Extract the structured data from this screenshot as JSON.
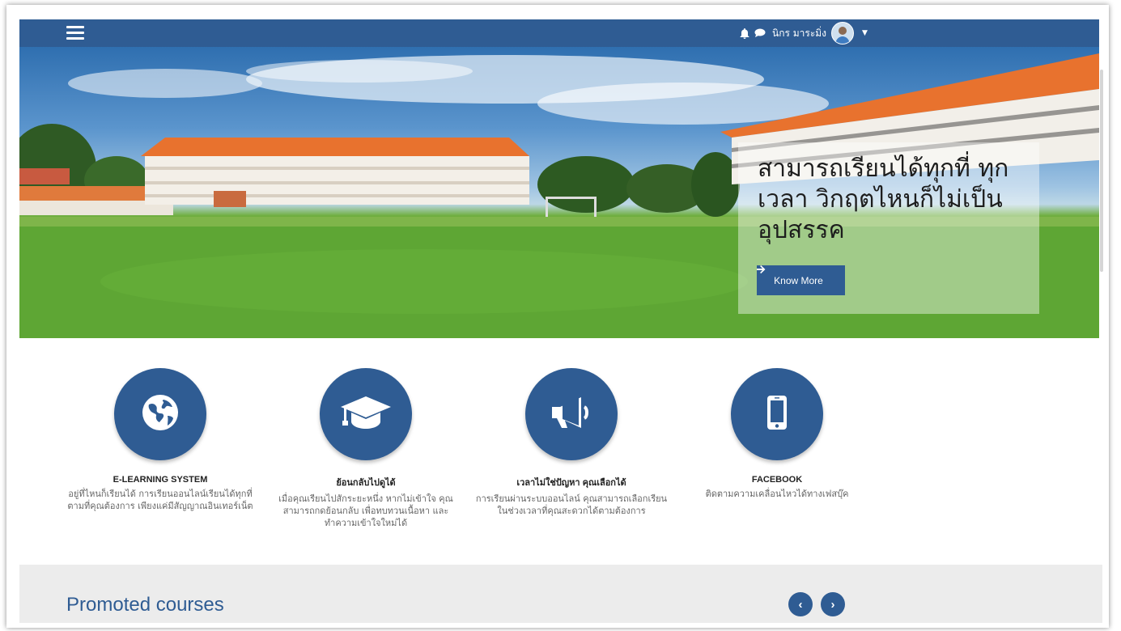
{
  "topbar": {
    "user_name": "นิกร มาระมิ่ง",
    "color": "#2f5c93"
  },
  "hero": {
    "title": "สามารถเรียนได้ทุกที่ ทุกเวลา วิกฤตไหนก็ไม่เป็นอุปสรรค",
    "button_label": "Know More"
  },
  "features": [
    {
      "icon": "globe-icon",
      "title": "E-LEARNING SYSTEM",
      "text": "อยู่ที่ไหนก็เรียนได้ การเรียนออนไลน์เรียนได้ทุกที่ ตามที่คุณต้องการ เพียงแค่มีสัญญาณอินเทอร์เน็ต"
    },
    {
      "icon": "graduation-cap-icon",
      "title": "ย้อนกลับไปดูได้",
      "text": "เมื่อคุณเรียนไปสักระยะหนึ่ง หากไม่เข้าใจ คุณสามารถกดย้อนกลับ เพื่อทบทวนเนื้อหา และทำความเข้าใจใหม่ได้"
    },
    {
      "icon": "megaphone-icon",
      "title": "เวลาไม่ใช่ปัญหา คุณเลือกได้",
      "text": "การเรียนผ่านระบบออนไลน์ คุณสามารถเลือกเรียนในช่วงเวลาที่คุณสะดวกได้ตามต้องการ"
    },
    {
      "icon": "mobile-phone-icon",
      "title": "FACEBOOK",
      "text": "ติดตามความเคลื่อนไหวได้ทางเฟสบุ๊ค"
    }
  ],
  "promoted": {
    "title": "Promoted courses",
    "prev_icon": "chevron-left-icon",
    "next_icon": "chevron-right-icon"
  }
}
